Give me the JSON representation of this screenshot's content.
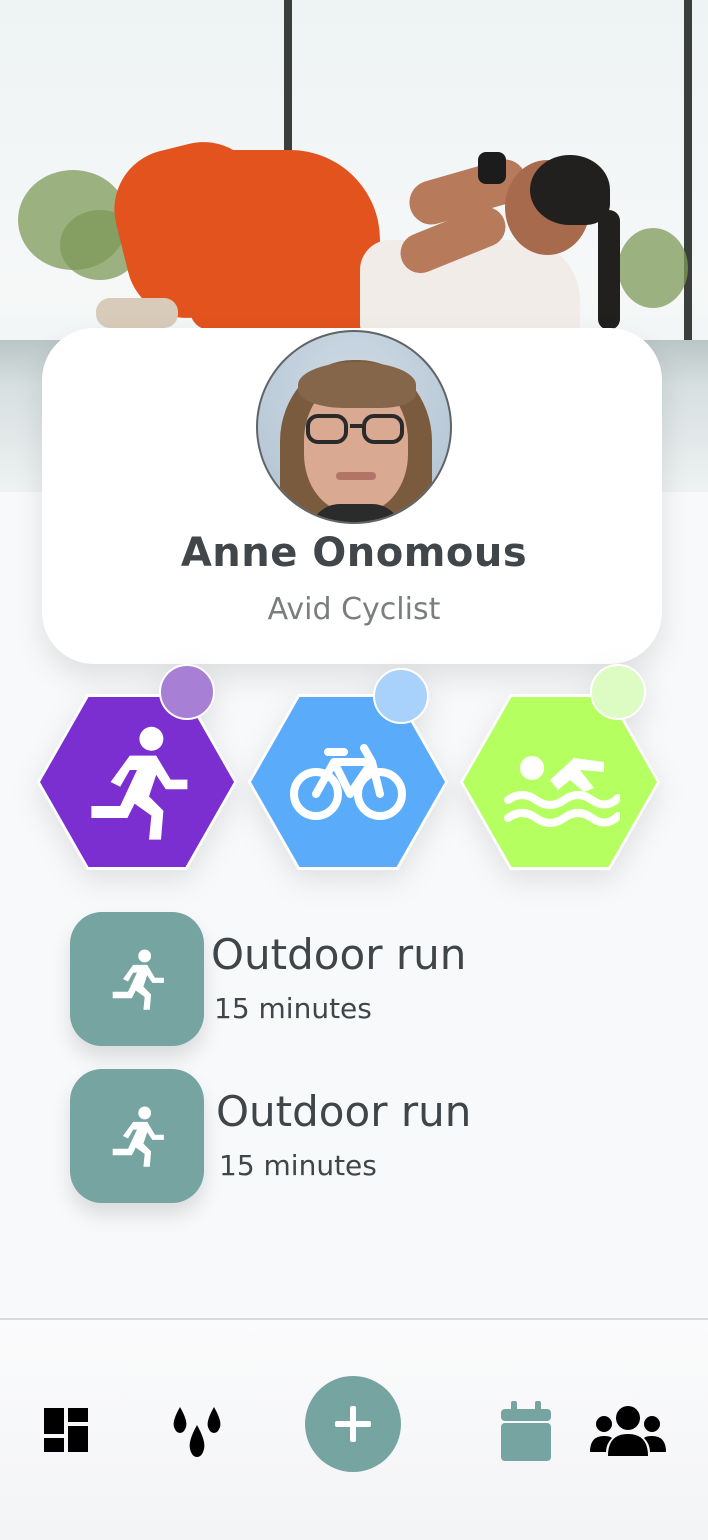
{
  "profile": {
    "name": "Anne Onomous",
    "subtitle": "Avid Cyclist"
  },
  "activity_types": [
    {
      "name": "running",
      "icon": "running-icon",
      "color": "#7b2fd0",
      "dot_color": "#a77fd4"
    },
    {
      "name": "cycling",
      "icon": "bicycle-icon",
      "color": "#5aacfb",
      "dot_color": "#a8d2fc"
    },
    {
      "name": "swimming",
      "icon": "swimmer-icon",
      "color": "#b5ff61",
      "dot_color": "#dcfcc3"
    }
  ],
  "activities": [
    {
      "title": "Outdoor run",
      "duration": "15 minutes",
      "icon": "running-icon"
    },
    {
      "title": "Outdoor run",
      "duration": "15 minutes",
      "icon": "running-icon"
    }
  ],
  "bottom_nav": {
    "items": [
      {
        "icon": "dashboard-icon"
      },
      {
        "icon": "water-drops-icon"
      },
      {
        "icon": "add-icon"
      },
      {
        "icon": "calendar-icon"
      },
      {
        "icon": "people-icon"
      }
    ],
    "accent_color": "#76a4a0"
  },
  "colors": {
    "background": "#f8f9fb",
    "text_primary": "#40464a",
    "text_secondary": "#7a7e80",
    "tile": "#76a4a0"
  }
}
